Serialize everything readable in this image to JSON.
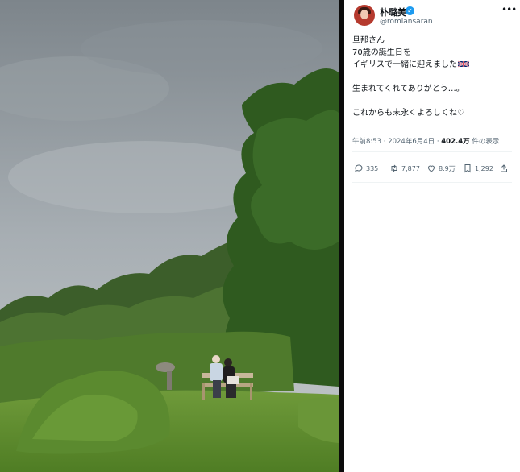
{
  "author": {
    "display_name": "朴璐美",
    "handle": "@romiansaran"
  },
  "tweet": {
    "lines": [
      "旦那さん",
      "70歳の誕生日を",
      "イギリスで一緒に迎えました"
    ],
    "line_4": "生まれてくれてありがとう…。",
    "line_5": "これからも末永くよろしくね♡"
  },
  "meta": {
    "time": "午前8:53",
    "separator": "·",
    "date": "2024年6月4日",
    "views": "402.4万",
    "views_suffix": "件の表示"
  },
  "actions": {
    "replies": "335",
    "retweets": "7,877",
    "likes": "8.9万",
    "bookmarks": "1,292"
  },
  "icons": {
    "verified": "verified-badge-icon",
    "more": "more-options-icon",
    "flag": "uk-flag-icon",
    "reply": "reply-icon",
    "retweet": "retweet-icon",
    "like": "heart-icon",
    "bookmark": "bookmark-icon",
    "share": "share-icon"
  },
  "colors": {
    "accent": "#1d9bf0",
    "text": "#0f1419",
    "muted": "#536471"
  }
}
